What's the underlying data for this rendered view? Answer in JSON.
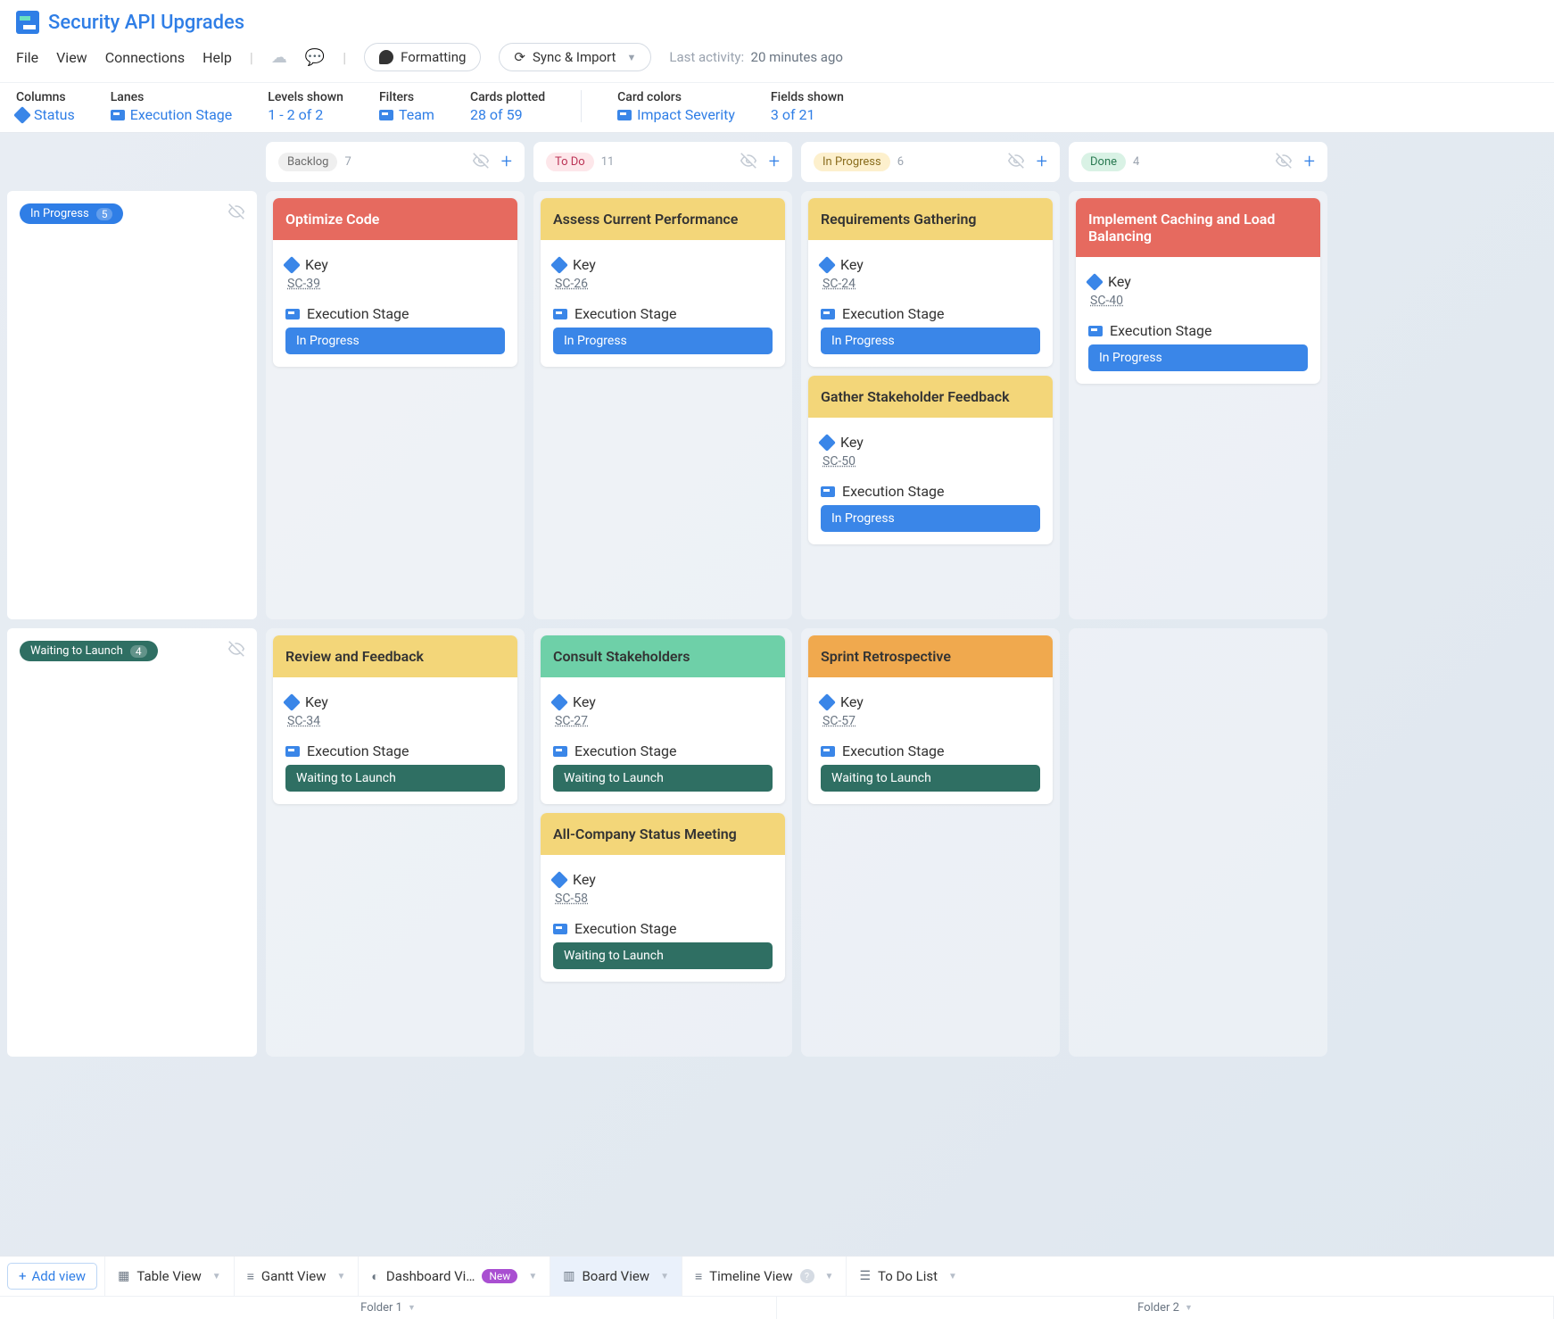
{
  "header": {
    "title": "Security API Upgrades",
    "menu": [
      "File",
      "View",
      "Connections",
      "Help"
    ],
    "formatting_btn": "Formatting",
    "sync_btn": "Sync & Import",
    "last_activity_label": "Last activity:",
    "last_activity_time": "20 minutes ago"
  },
  "filters": {
    "columns": {
      "label": "Columns",
      "value": "Status"
    },
    "lanes": {
      "label": "Lanes",
      "value": "Execution Stage"
    },
    "levels": {
      "label": "Levels shown",
      "value": "1 - 2 of 2"
    },
    "filters": {
      "label": "Filters",
      "value": "Team"
    },
    "cards": {
      "label": "Cards plotted",
      "value": "28 of 59"
    },
    "colors": {
      "label": "Card colors",
      "value": "Impact Severity"
    },
    "fields": {
      "label": "Fields shown",
      "value": "3 of 21"
    }
  },
  "columns": [
    {
      "name": "Backlog",
      "count": 7,
      "cls": "backlog"
    },
    {
      "name": "To Do",
      "count": 11,
      "cls": "todo"
    },
    {
      "name": "In Progress",
      "count": 6,
      "cls": "inprog"
    },
    {
      "name": "Done",
      "count": 4,
      "cls": "done"
    }
  ],
  "lanes": [
    {
      "name": "In Progress",
      "count": 5,
      "cls": "inprogress"
    },
    {
      "name": "Waiting to Launch",
      "count": 4,
      "cls": "waiting"
    }
  ],
  "field_labels": {
    "key": "Key",
    "stage": "Execution Stage"
  },
  "stage_values": {
    "inprogress": "In Progress",
    "waiting": "Waiting to Launch"
  },
  "cards": {
    "lane0": {
      "col0": [
        {
          "title": "Optimize Code",
          "color": "red",
          "key": "SC-39",
          "stage": "inprogress"
        }
      ],
      "col1": [
        {
          "title": "Assess Current Performance",
          "color": "yellow",
          "key": "SC-26",
          "stage": "inprogress"
        }
      ],
      "col2": [
        {
          "title": "Requirements Gathering",
          "color": "yellow",
          "key": "SC-24",
          "stage": "inprogress"
        },
        {
          "title": "Gather Stakeholder Feedback",
          "color": "yellow",
          "key": "SC-50",
          "stage": "inprogress"
        }
      ],
      "col3": [
        {
          "title": "Implement Caching and Load Balancing",
          "color": "red",
          "key": "SC-40",
          "stage": "inprogress"
        }
      ]
    },
    "lane1": {
      "col0": [
        {
          "title": "Review and Feedback",
          "color": "yellow",
          "key": "SC-34",
          "stage": "waiting"
        }
      ],
      "col1": [
        {
          "title": "Consult Stakeholders",
          "color": "green",
          "key": "SC-27",
          "stage": "waiting"
        },
        {
          "title": "All-Company Status Meeting",
          "color": "yellow",
          "key": "SC-58",
          "stage": "waiting"
        }
      ],
      "col2": [
        {
          "title": "Sprint Retrospective",
          "color": "orange",
          "key": "SC-57",
          "stage": "waiting"
        }
      ],
      "col3": []
    }
  },
  "bottom": {
    "add_view": "Add view",
    "tabs": [
      {
        "label": "Table View",
        "icon": "▦"
      },
      {
        "label": "Gantt View",
        "icon": "≡"
      },
      {
        "label": "Dashboard Vi…",
        "icon": "◐",
        "new": "New"
      },
      {
        "label": "Board View",
        "icon": "▥",
        "active": true
      },
      {
        "label": "Timeline View",
        "icon": "≡",
        "help": true
      },
      {
        "label": "To Do List",
        "icon": "☰"
      }
    ],
    "folders": [
      "Folder 1",
      "Folder 2"
    ]
  }
}
